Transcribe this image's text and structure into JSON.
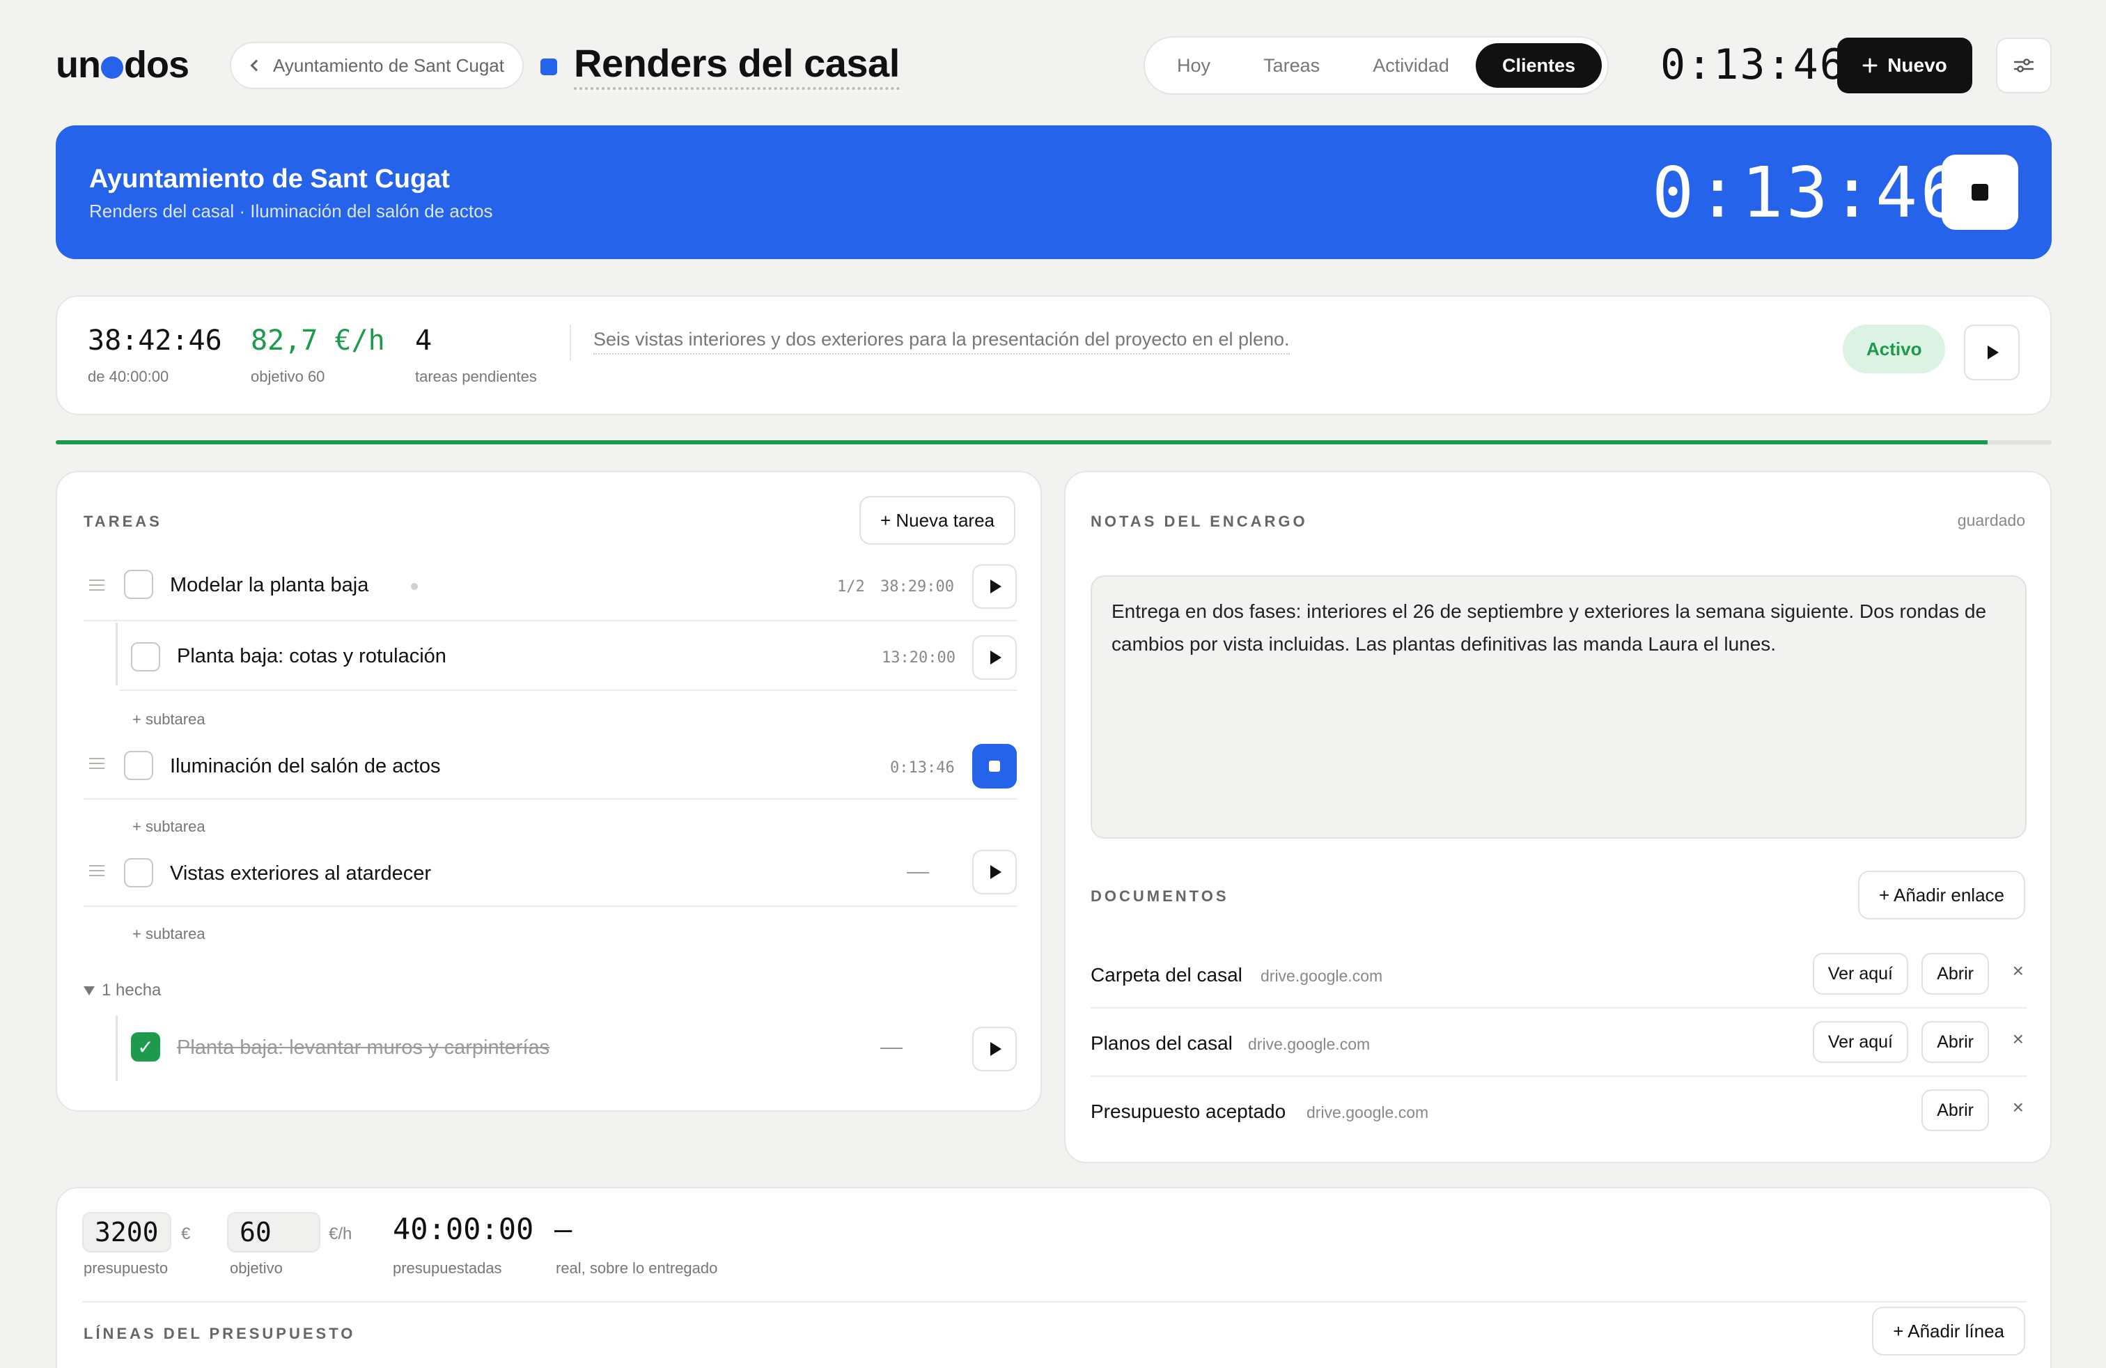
{
  "header": {
    "logo_pre": "un",
    "logo_post": "dos",
    "breadcrumb_label": "Ayuntamiento de Sant Cugat",
    "project_title": "Renders del casal",
    "nav_tabs": [
      "Hoy",
      "Tareas",
      "Actividad",
      "Clientes"
    ],
    "active_tab": "Clientes",
    "timer": "0:13:46",
    "new_button_label": "Nuevo",
    "new_button_icon": "plus-icon",
    "settings_icon": "sliders-icon"
  },
  "banner": {
    "client": "Ayuntamiento de Sant Cugat",
    "subtitle": "Renders del casal · Iluminación del salón de actos",
    "timer": "0:13:46",
    "color": "#2563eb"
  },
  "stats": {
    "total_time": "38:42:46",
    "total_time_label": "de 40:00:00",
    "rate": "82,7 €/h",
    "rate_label": "objetivo 60",
    "pending": "4",
    "pending_label": "tareas pendientes",
    "description": "Seis vistas interiores y dos exteriores para la presentación del proyecto en el pleno.",
    "status": "Activo",
    "progress_fraction": 0.968
  },
  "tasks": {
    "title": "TAREAS",
    "new_task_label": "+ Nueva tarea",
    "add_subtask_label": "+ subtarea",
    "items": [
      {
        "name": "Modelar la planta baja",
        "count": "1/2",
        "time": "38:29:00"
      },
      {
        "name": "Planta baja: cotas y rotulación",
        "time": "13:20:00"
      },
      {
        "name": "Iluminación del salón de actos",
        "time": "0:13:46"
      },
      {
        "name": "Vistas exteriores al atardecer"
      }
    ],
    "done_toggle": "1 hecha",
    "done_items": [
      {
        "name": "Planta baja: levantar muros y carpinterías"
      }
    ]
  },
  "notes": {
    "title": "NOTAS DEL ENCARGO",
    "status": "guardado",
    "text": "Entrega en dos fases: interiores el 26 de septiembre y exteriores la semana siguiente. Dos rondas de cambios por vista incluidas. Las plantas definitivas las manda Laura el lunes."
  },
  "documents": {
    "title": "DOCUMENTOS",
    "add_link_label": "+ Añadir enlace",
    "view_label": "Ver aquí",
    "open_label": "Abrir",
    "items": [
      {
        "name": "Carpeta del casal",
        "domain": "drive.google.com"
      },
      {
        "name": "Planos del casal",
        "domain": "drive.google.com"
      },
      {
        "name": "Presupuesto aceptado",
        "domain": "drive.google.com"
      }
    ]
  },
  "budget": {
    "amount": "3200",
    "amount_unit": "€",
    "amount_label": "presupuesto",
    "target": "60",
    "target_unit": "€/h",
    "target_label": "objetivo",
    "budgeted_hours": "40:00:00",
    "budgeted_label": "presupuestadas",
    "real": "–",
    "real_label": "real, sobre lo entregado",
    "lines_title": "LÍNEAS DEL PRESUPUESTO",
    "add_line_label": "+ Añadir línea"
  }
}
